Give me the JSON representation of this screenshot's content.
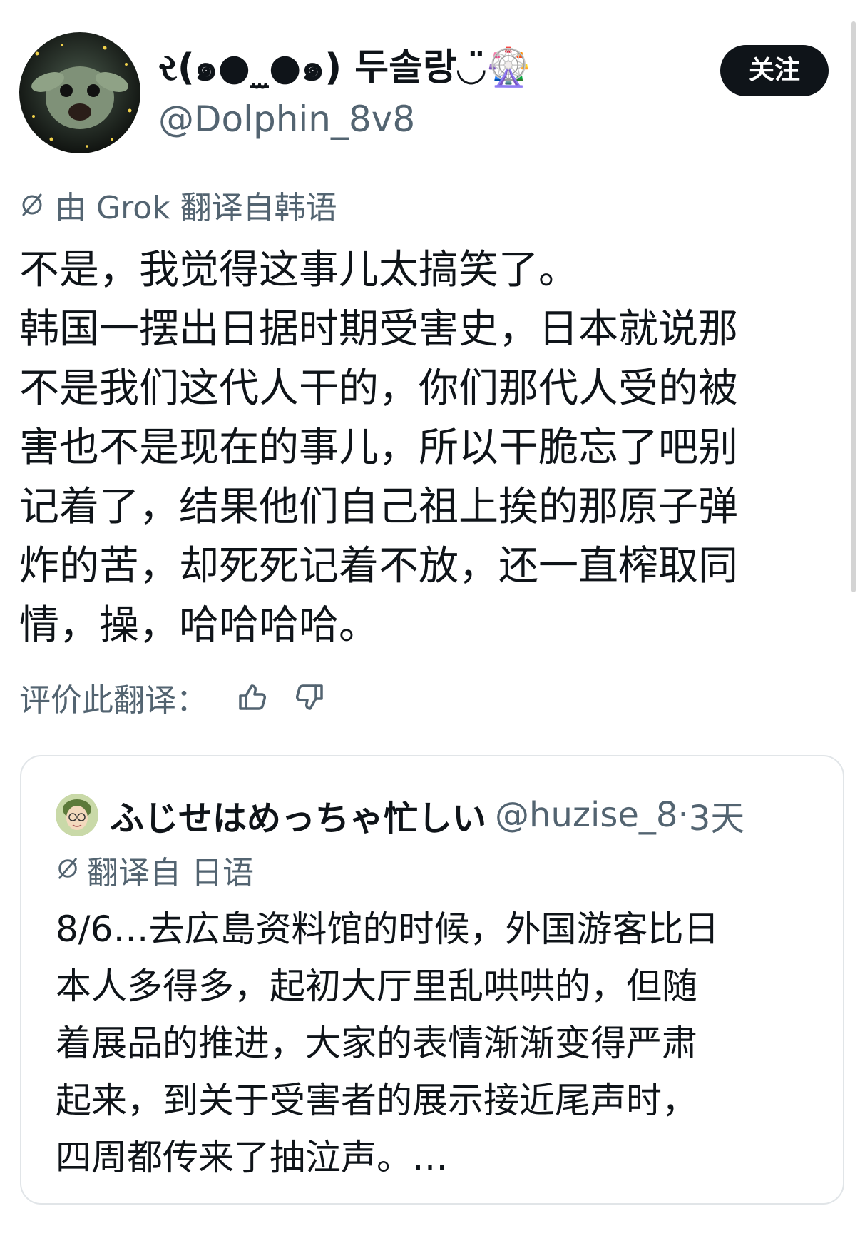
{
  "post": {
    "display_name": "ર(๑●_̫●๑) 두솔랑◡̈🎡",
    "handle": "@Dolphin_8v8",
    "follow_label": "关注",
    "translated_note": "由 Grok 翻译自韩语",
    "body_lines": [
      "不是，我觉得这事儿太搞笑了。",
      "韩国一摆出日据时期受害史，日本就说那",
      "不是我们这代人干的，你们那代人受的被",
      "害也不是现在的事儿，所以干脆忘了吧别",
      "记着了，结果他们自己祖上挨的那原子弹",
      "炸的苦，却死死记着不放，还一直榨取同",
      "情，操，哈哈哈哈。"
    ],
    "rate_label": "评价此翻译："
  },
  "quote": {
    "name": "ふじせはめっちゃ忙しい",
    "handle": "@huzise_8",
    "separator": "·",
    "time": "3天",
    "translated_note": "翻译自 日语",
    "body_lines": [
      "8/6…去広島资料馆的时候，外国游客比日",
      "本人多得多，起初大厅里乱哄哄的，但随",
      "着展品的推进，大家的表情渐渐变得严肃",
      "起来，到关于受害者的展示接近尾声时，",
      "四周都传来了抽泣声。…"
    ]
  },
  "icons": {
    "translate": "translate-slash-icon",
    "like": "thumbs-up-icon",
    "dislike": "thumbs-down-icon"
  },
  "colors": {
    "text": "#0f1419",
    "secondary": "#536471",
    "button_bg": "#0f1419",
    "border": "#e1e5e8"
  }
}
